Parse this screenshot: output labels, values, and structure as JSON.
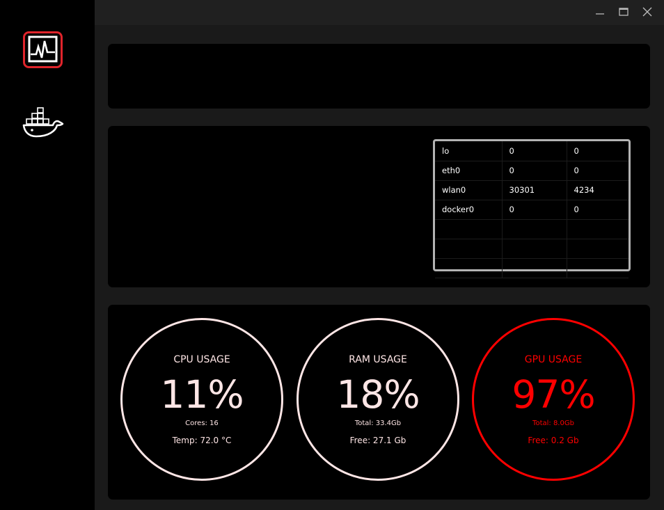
{
  "sidebar": {
    "items": [
      {
        "icon": "system-monitor-icon",
        "active": true,
        "accent": "#e0242b"
      },
      {
        "icon": "docker-whale-icon",
        "active": false
      }
    ]
  },
  "window_controls": [
    "minimize",
    "maximize",
    "close"
  ],
  "network": {
    "rows": [
      [
        "lo",
        "0",
        "0"
      ],
      [
        "eth0",
        "0",
        "0"
      ],
      [
        "wlan0",
        "30301",
        "4234"
      ],
      [
        "docker0",
        "0",
        "0"
      ],
      [
        "",
        "",
        ""
      ],
      [
        "",
        "",
        ""
      ],
      [
        "",
        "",
        ""
      ]
    ]
  },
  "gauges": {
    "cpu": {
      "title": "CPU USAGE",
      "value": "11%",
      "percent": 11,
      "sub1": "Cores: 16",
      "sub2": "Temp: 72.0 °C",
      "color": "#ffe6e6"
    },
    "ram": {
      "title": "RAM USAGE",
      "value": "18%",
      "percent": 18,
      "sub1": "Total: 33.4Gb",
      "sub2": "Free: 27.1 Gb",
      "color": "#ffe6e6"
    },
    "gpu": {
      "title": "GPU USAGE",
      "value": "97%",
      "percent": 97,
      "sub1": "Total: 8.0Gb",
      "sub2": "Free: 0.2 Gb",
      "color": "#ff0000"
    }
  }
}
